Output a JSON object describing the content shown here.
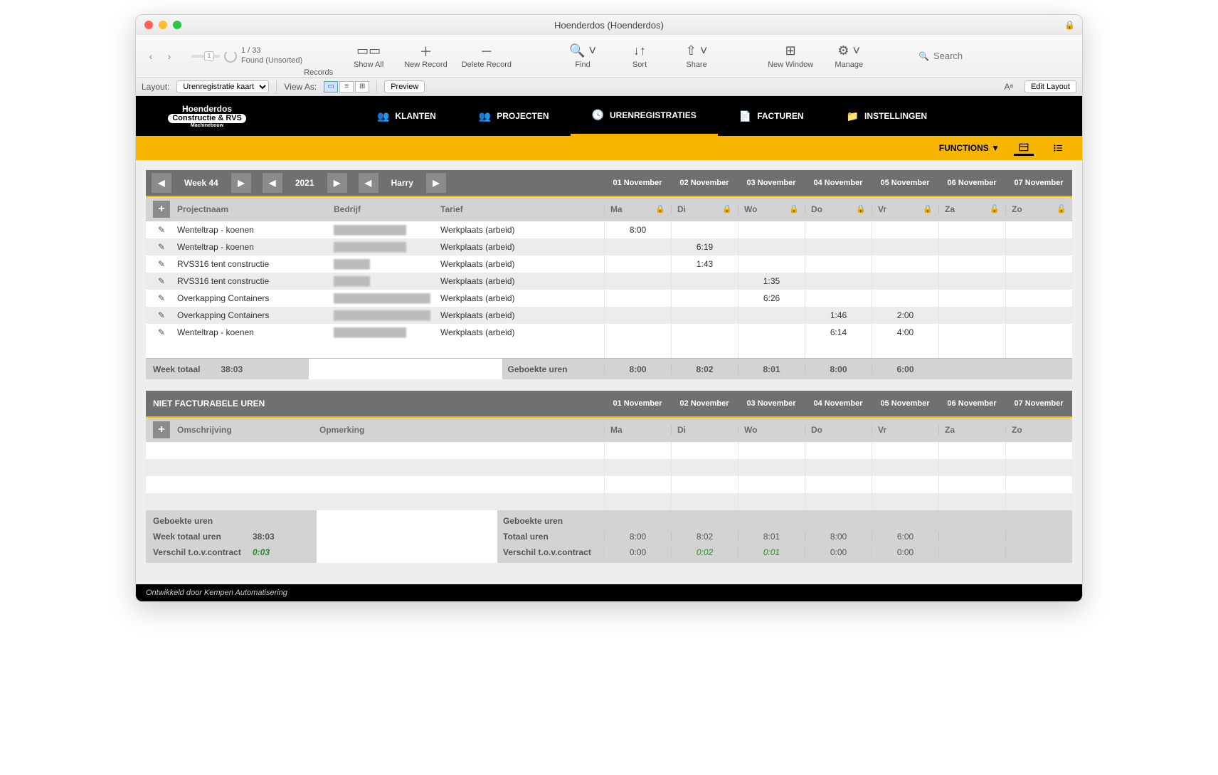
{
  "window": {
    "title": "Hoenderdos (Hoenderdos)"
  },
  "toolbar": {
    "slider_value": "1",
    "record_count": "1 / 33",
    "record_status": "Found (Unsorted)",
    "records_label": "Records",
    "show_all": "Show All",
    "new_record": "New Record",
    "delete_record": "Delete Record",
    "find": "Find",
    "sort": "Sort",
    "share": "Share",
    "new_window": "New Window",
    "manage": "Manage",
    "search_placeholder": "Search"
  },
  "layoutbar": {
    "layout_label": "Layout:",
    "layout_value": "Urenregistratie kaart",
    "view_as": "View As:",
    "preview": "Preview",
    "edit_layout": "Edit Layout",
    "aa": "Aᵃ"
  },
  "logo": {
    "top": "Hoenderdos",
    "mid": "Constructie & RVS",
    "sub": "Machinebouw"
  },
  "nav": {
    "klanten": "KLANTEN",
    "projecten": "PROJECTEN",
    "urenregistraties": "URENREGISTRATIES",
    "facturen": "FACTUREN",
    "instellingen": "INSTELLINGEN"
  },
  "functions": {
    "label": "FUNCTIONS ▼"
  },
  "navigator": {
    "week": "Week 44",
    "year": "2021",
    "person": "Harry",
    "days": [
      "01 November",
      "02 November",
      "03 November",
      "04 November",
      "05 November",
      "06 November",
      "07 November"
    ]
  },
  "columns": {
    "projectnaam": "Projectnaam",
    "bedrijf": "Bedrijf",
    "tarief": "Tarief",
    "day_short": [
      "Ma",
      "Di",
      "Wo",
      "Do",
      "Vr",
      "Za",
      "Zo"
    ]
  },
  "rows": [
    {
      "name": "Wenteltrap - koenen",
      "company": "████████████",
      "tarief": "Werkplaats (arbeid)",
      "hours": [
        "8:00",
        "",
        "",
        "",
        "",
        "",
        ""
      ]
    },
    {
      "name": "Wenteltrap - koenen",
      "company": "████████████",
      "tarief": "Werkplaats (arbeid)",
      "hours": [
        "",
        "6:19",
        "",
        "",
        "",
        "",
        ""
      ]
    },
    {
      "name": "RVS316 tent constructie",
      "company": "██████",
      "tarief": "Werkplaats (arbeid)",
      "hours": [
        "",
        "1:43",
        "",
        "",
        "",
        "",
        ""
      ]
    },
    {
      "name": "RVS316 tent constructie",
      "company": "██████",
      "tarief": "Werkplaats (arbeid)",
      "hours": [
        "",
        "",
        "1:35",
        "",
        "",
        "",
        ""
      ]
    },
    {
      "name": "Overkapping  Containers",
      "company": "████████████████",
      "tarief": "Werkplaats (arbeid)",
      "hours": [
        "",
        "",
        "6:26",
        "",
        "",
        "",
        ""
      ]
    },
    {
      "name": "Overkapping  Containers",
      "company": "████████████████",
      "tarief": "Werkplaats (arbeid)",
      "hours": [
        "",
        "",
        "",
        "1:46",
        "2:00",
        "",
        ""
      ]
    },
    {
      "name": "Wenteltrap - koenen",
      "company": "████████████",
      "tarief": "Werkplaats (arbeid)",
      "hours": [
        "",
        "",
        "",
        "6:14",
        "4:00",
        "",
        ""
      ]
    }
  ],
  "totals": {
    "week_totaal_label": "Week totaal",
    "week_totaal_value": "38:03",
    "geboekte_uren_label": "Geboekte uren",
    "per_day": [
      "8:00",
      "8:02",
      "8:01",
      "8:00",
      "6:00",
      "",
      ""
    ]
  },
  "niet_facturabel": {
    "title": "NIET FACTURABELE UREN",
    "omschrijving": "Omschrijving",
    "opmerking": "Opmerking"
  },
  "summary": {
    "geboekte_uren": "Geboekte uren",
    "week_totaal_uren": "Week totaal uren",
    "week_totaal_val": "38:03",
    "verschil": "Verschil t.o.v.contract",
    "verschil_val": "0:03",
    "totaal_uren": "Totaal uren",
    "totaal_per_day": [
      "8:00",
      "8:02",
      "8:01",
      "8:00",
      "6:00",
      "",
      ""
    ],
    "verschil_per_day": [
      "0:00",
      "0:02",
      "0:01",
      "0:00",
      "0:00",
      "",
      ""
    ]
  },
  "footer": "Ontwikkeld door Kempen Automatisering"
}
